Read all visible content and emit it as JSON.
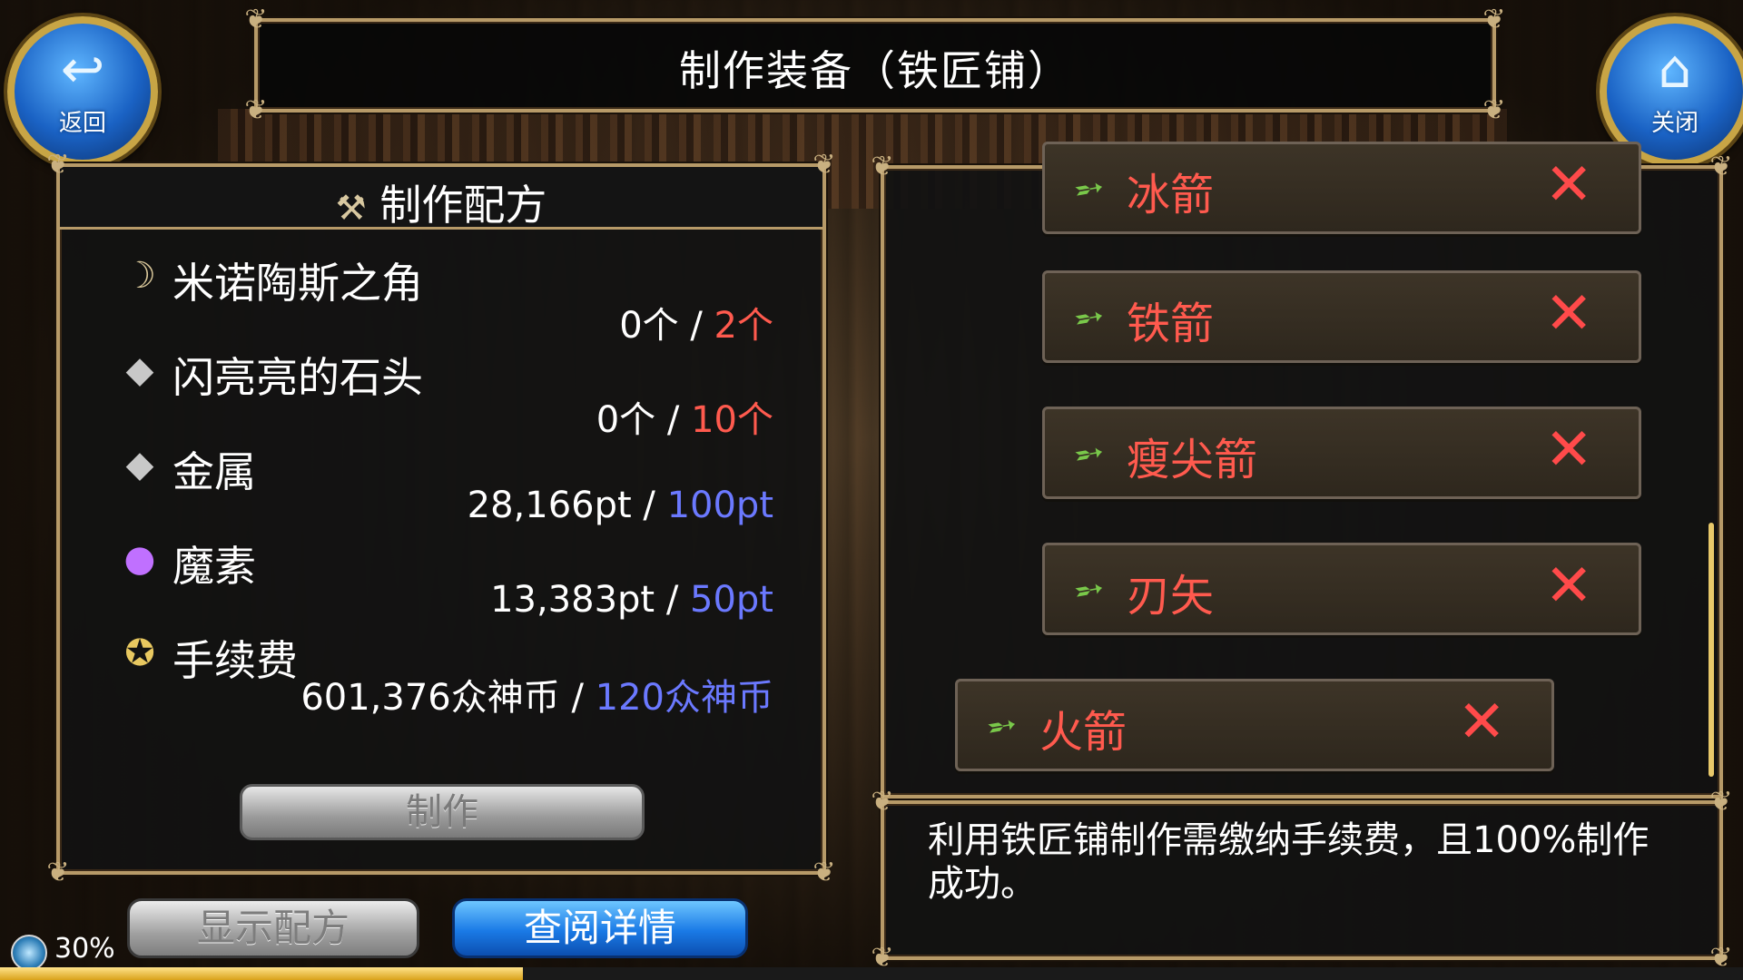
{
  "header": {
    "title": "制作装备（铁匠铺）",
    "back_label": "返回",
    "close_label": "关闭"
  },
  "recipe": {
    "title": "制作配方",
    "materials": [
      {
        "name": "米诺陶斯之角",
        "have": "0个",
        "sep": " / ",
        "need": "2个",
        "need_color": "red",
        "icon": "horn-icon"
      },
      {
        "name": "闪亮亮的石头",
        "have": "0个",
        "sep": " / ",
        "need": "10个",
        "need_color": "red",
        "icon": "stone-icon"
      },
      {
        "name": "金属",
        "have": "28,166pt",
        "sep": " / ",
        "need": "100pt",
        "need_color": "blue",
        "icon": "metal-icon"
      },
      {
        "name": "魔素",
        "have": "13,383pt",
        "sep": " / ",
        "need": "50pt",
        "need_color": "blue",
        "icon": "mana-orb-icon"
      },
      {
        "name": "手续费",
        "have": "601,376众神币",
        "sep": " / ",
        "need": "120众神币",
        "need_color": "blue",
        "icon": "coins-icon"
      }
    ],
    "make_label": "制作"
  },
  "buttons": {
    "show_recipe": "显示配方",
    "view_details": "查阅详情"
  },
  "progress": {
    "text": "30%",
    "value": 0.3
  },
  "weapons": [
    {
      "name": "冰箭",
      "status": "✕"
    },
    {
      "name": "铁箭",
      "status": "✕"
    },
    {
      "name": "瘦尖箭",
      "status": "✕"
    },
    {
      "name": "刃矢",
      "status": "✕"
    },
    {
      "name": "火箭",
      "status": "✕"
    }
  ],
  "description": "利用铁匠铺制作需缴纳手续费，且100%制作成功。",
  "colors": {
    "red": "#ff5a4e",
    "blue": "#6b79ff",
    "frame": "#b79a68",
    "accent_blue": "#1a7ae6"
  }
}
